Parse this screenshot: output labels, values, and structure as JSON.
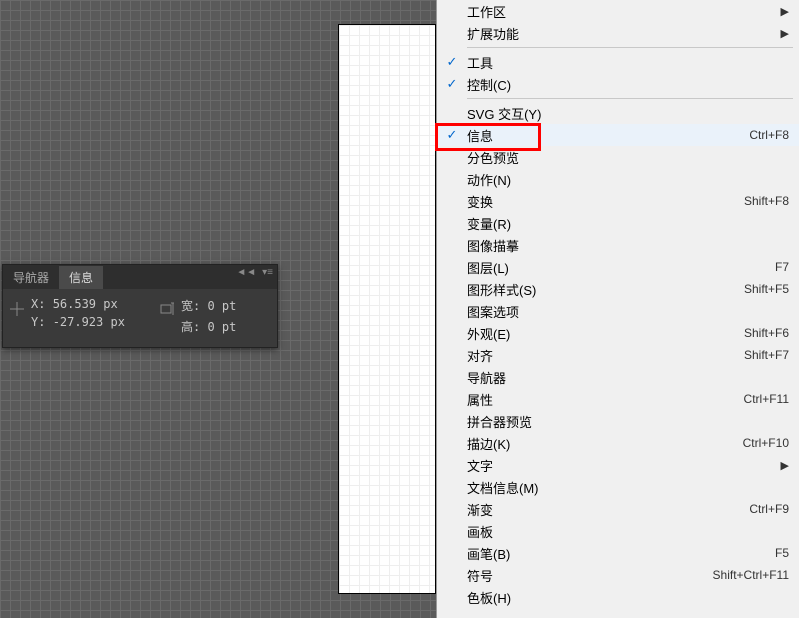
{
  "info_panel": {
    "tab1": "导航器",
    "tab2": "信息",
    "x_label": "X:",
    "x_value": "56.539 px",
    "y_label": "Y:",
    "y_value": "-27.923 px",
    "w_label": "宽:",
    "w_value": "0 pt",
    "h_label": "高:",
    "h_value": "0 pt"
  },
  "menu": {
    "items": [
      {
        "label": "工作区",
        "check": false,
        "shortcut": "",
        "arrow": true
      },
      {
        "label": "扩展功能",
        "check": false,
        "shortcut": "",
        "arrow": true
      },
      {
        "sep": true
      },
      {
        "label": "工具",
        "check": true,
        "shortcut": "",
        "arrow": false
      },
      {
        "label": "控制(C)",
        "check": true,
        "shortcut": "",
        "arrow": false
      },
      {
        "sep": true
      },
      {
        "label": "SVG 交互(Y)",
        "check": false,
        "shortcut": "",
        "arrow": false
      },
      {
        "label": "信息",
        "check": true,
        "shortcut": "Ctrl+F8",
        "arrow": false,
        "highlighted": true
      },
      {
        "label": "分色预览",
        "check": false,
        "shortcut": "",
        "arrow": false
      },
      {
        "label": "动作(N)",
        "check": false,
        "shortcut": "",
        "arrow": false
      },
      {
        "label": "变换",
        "check": false,
        "shortcut": "Shift+F8",
        "arrow": false
      },
      {
        "label": "变量(R)",
        "check": false,
        "shortcut": "",
        "arrow": false
      },
      {
        "label": "图像描摹",
        "check": false,
        "shortcut": "",
        "arrow": false
      },
      {
        "label": "图层(L)",
        "check": false,
        "shortcut": "F7",
        "arrow": false
      },
      {
        "label": "图形样式(S)",
        "check": false,
        "shortcut": "Shift+F5",
        "arrow": false
      },
      {
        "label": "图案选项",
        "check": false,
        "shortcut": "",
        "arrow": false
      },
      {
        "label": "外观(E)",
        "check": false,
        "shortcut": "Shift+F6",
        "arrow": false
      },
      {
        "label": "对齐",
        "check": false,
        "shortcut": "Shift+F7",
        "arrow": false
      },
      {
        "label": "导航器",
        "check": false,
        "shortcut": "",
        "arrow": false
      },
      {
        "label": "属性",
        "check": false,
        "shortcut": "Ctrl+F11",
        "arrow": false
      },
      {
        "label": "拼合器预览",
        "check": false,
        "shortcut": "",
        "arrow": false
      },
      {
        "label": "描边(K)",
        "check": false,
        "shortcut": "Ctrl+F10",
        "arrow": false
      },
      {
        "label": "文字",
        "check": false,
        "shortcut": "",
        "arrow": true
      },
      {
        "label": "文档信息(M)",
        "check": false,
        "shortcut": "",
        "arrow": false
      },
      {
        "label": "渐变",
        "check": false,
        "shortcut": "Ctrl+F9",
        "arrow": false
      },
      {
        "label": "画板",
        "check": false,
        "shortcut": "",
        "arrow": false
      },
      {
        "label": "画笔(B)",
        "check": false,
        "shortcut": "F5",
        "arrow": false
      },
      {
        "label": "符号",
        "check": false,
        "shortcut": "Shift+Ctrl+F11",
        "arrow": false
      },
      {
        "label": "色板(H)",
        "check": false,
        "shortcut": "",
        "arrow": false
      }
    ]
  }
}
